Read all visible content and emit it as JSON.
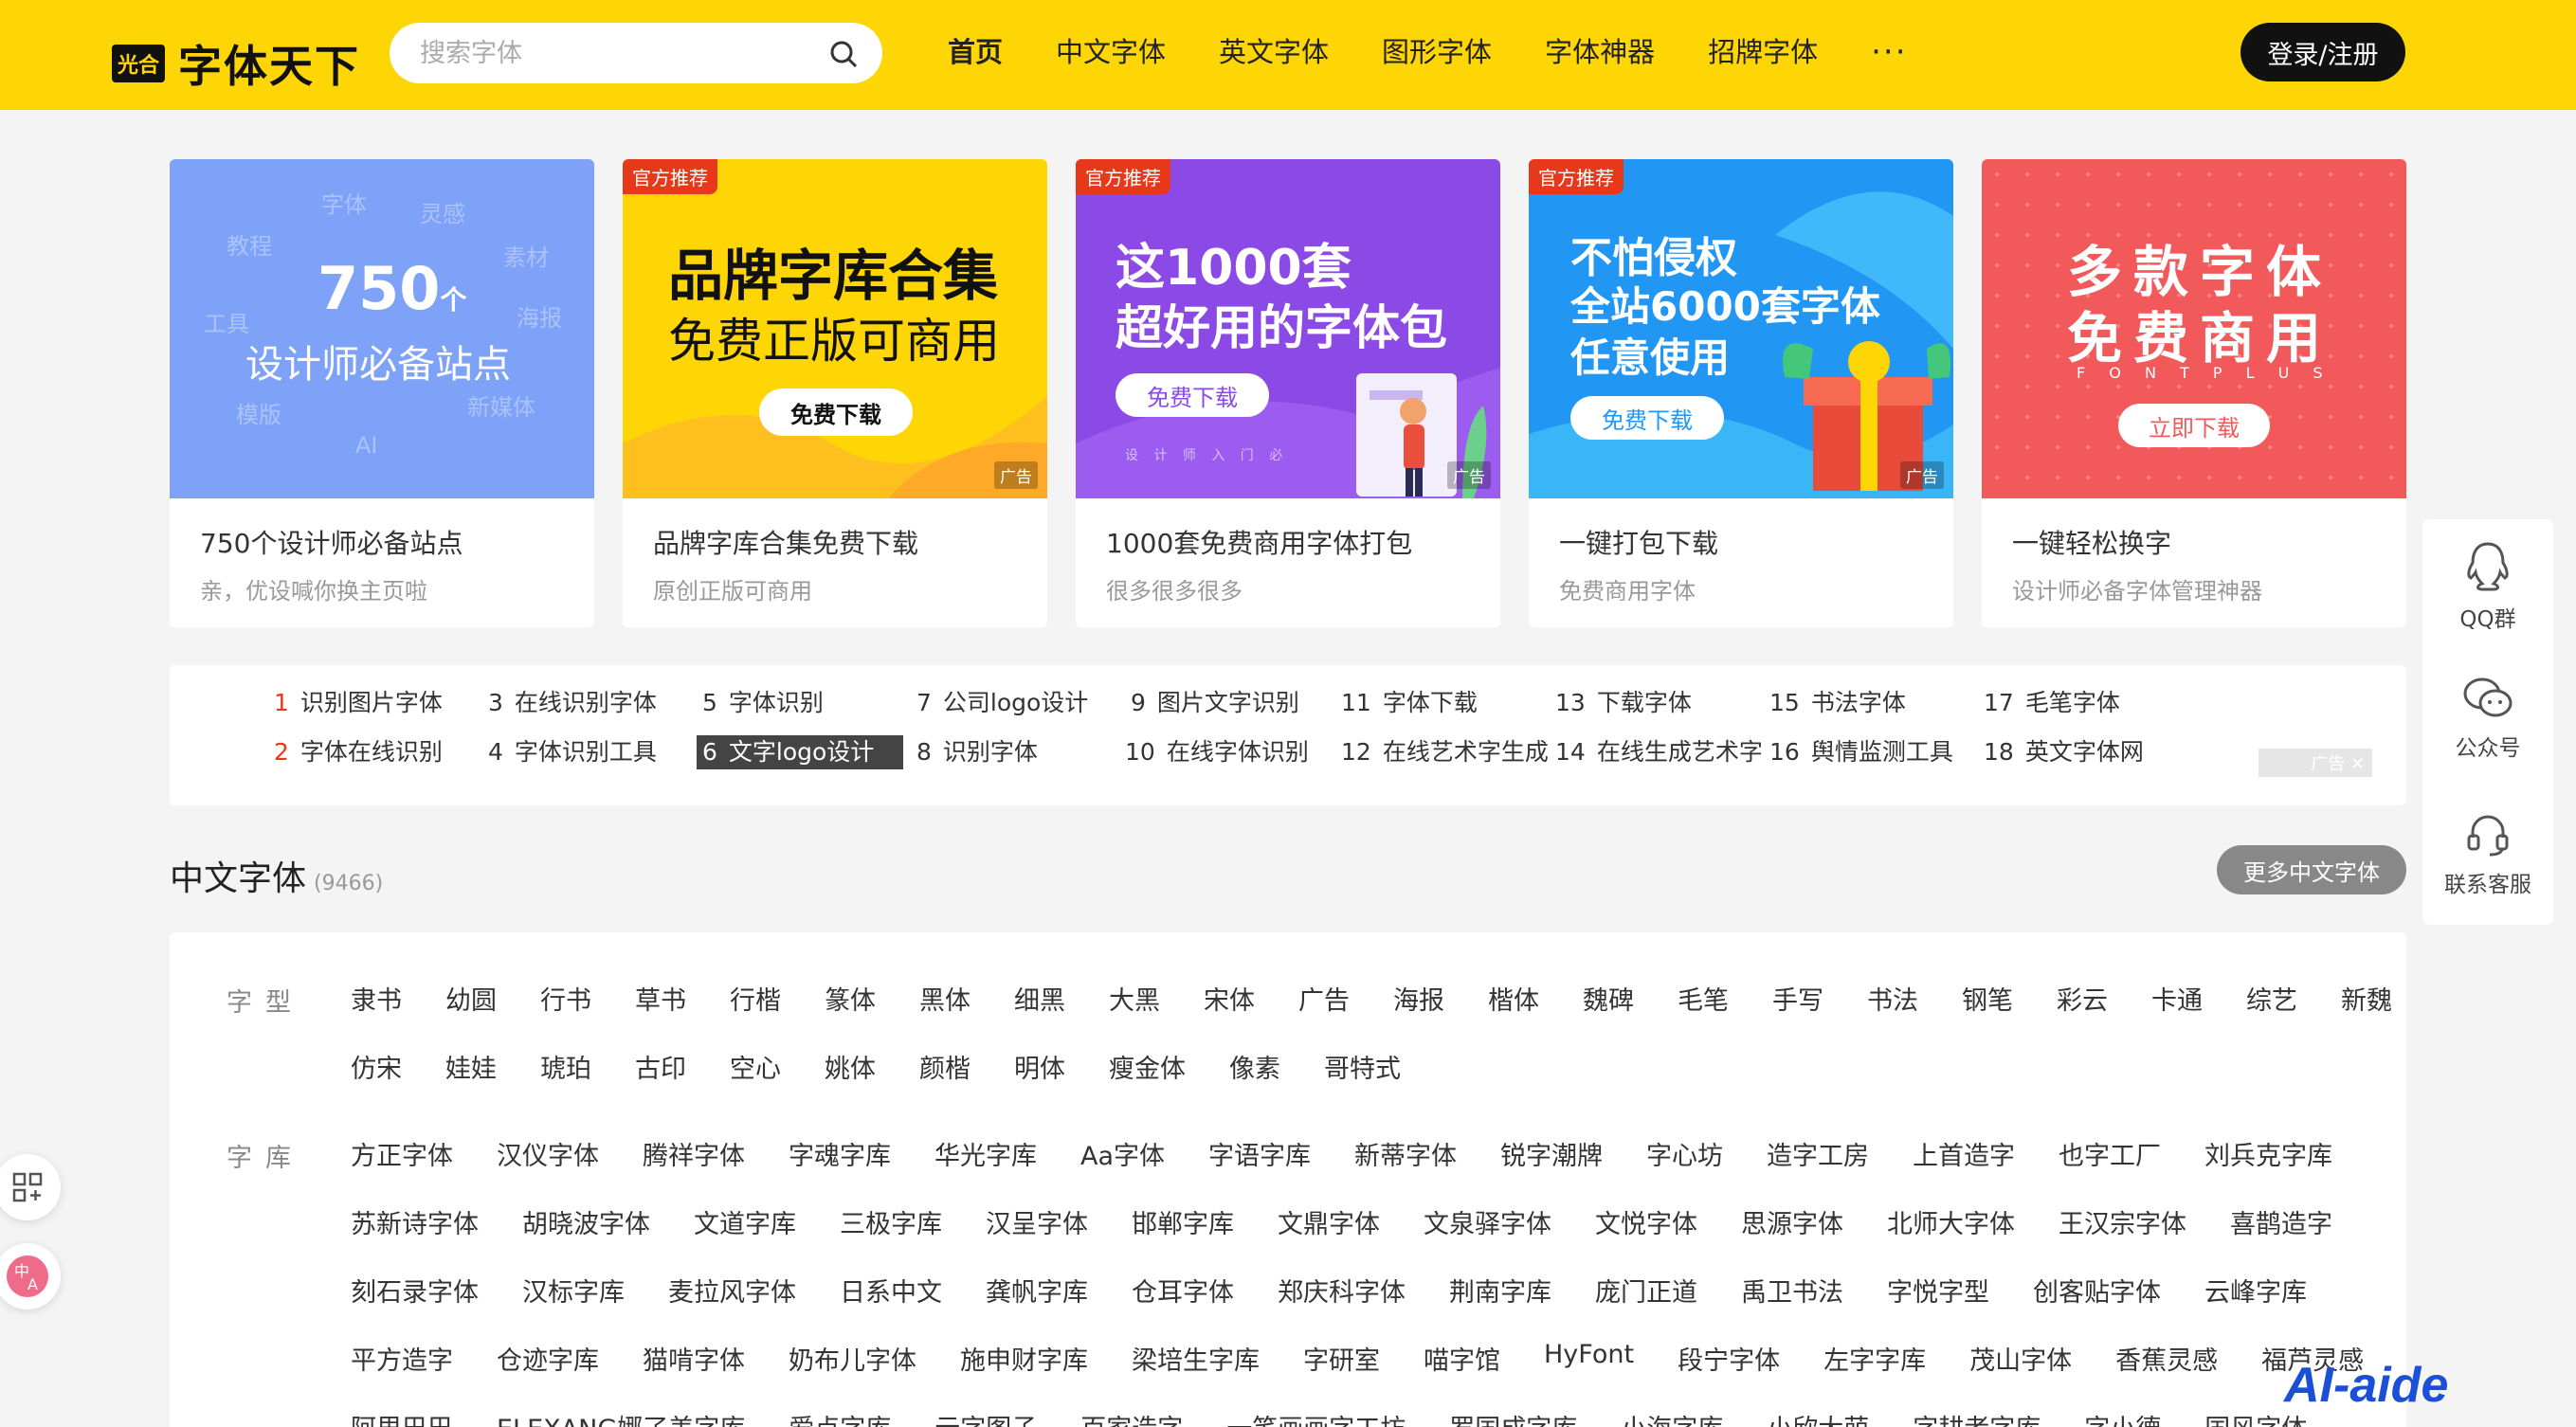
{
  "header": {
    "logo_badge": "光合",
    "logo_text": "字体天下",
    "search_placeholder": "搜索字体",
    "nav": [
      "首页",
      "中文字体",
      "英文字体",
      "图形字体",
      "字体神器",
      "招牌字体"
    ],
    "more": "···",
    "login": "登录/注册",
    "brand_color": "#fed505"
  },
  "cards": [
    {
      "title": "750个设计师必备站点",
      "sub": "亲，优设喊你换主页啦",
      "banner_num": "750",
      "banner_unit": "个",
      "banner_line": "设计师必备站点",
      "floating_words": [
        "字体",
        "灵感",
        "教程",
        "素材",
        "工具",
        "海报",
        "模版",
        "新媒体",
        "AI"
      ]
    },
    {
      "title": "品牌字库合集免费下载",
      "sub": "原创正版可商用",
      "tag": "官方推荐",
      "line1": "品牌字库合集",
      "line2": "免费正版可商用",
      "button": "免费下载",
      "ad": "广告"
    },
    {
      "title": "1000套免费商用字体打包",
      "sub": "很多很多很多",
      "tag": "官方推荐",
      "line1": "这1000套",
      "line2": "超好用的字体包",
      "button": "免费下载",
      "steps": "设  计  师  入  门  必",
      "ad": "广告"
    },
    {
      "title": "一键打包下载",
      "sub": "免费商用字体",
      "tag": "官方推荐",
      "line1": "不怕侵权",
      "line2": "全站6000套字体",
      "line3": "任意使用",
      "button": "免费下载",
      "ad": "广告"
    },
    {
      "title": "一键轻松换字",
      "sub": "设计师必备字体管理神器",
      "line1": "多款字体",
      "line2": "免费商用",
      "line3": "F O N T P L U S",
      "button": "立即下载"
    }
  ],
  "hot": {
    "items": [
      {
        "n": "1",
        "t": "识别图片字体"
      },
      {
        "n": "2",
        "t": "字体在线识别"
      },
      {
        "n": "3",
        "t": "在线识别字体"
      },
      {
        "n": "4",
        "t": "字体识别工具"
      },
      {
        "n": "5",
        "t": "字体识别"
      },
      {
        "n": "6",
        "t": "文字logo设计"
      },
      {
        "n": "7",
        "t": "公司logo设计"
      },
      {
        "n": "8",
        "t": "识别字体"
      },
      {
        "n": "9",
        "t": "图片文字识别"
      },
      {
        "n": "10",
        "t": "在线字体识别"
      },
      {
        "n": "11",
        "t": "字体下载"
      },
      {
        "n": "12",
        "t": "在线艺术字生成"
      },
      {
        "n": "13",
        "t": "下载字体"
      },
      {
        "n": "14",
        "t": "在线生成艺术字"
      },
      {
        "n": "15",
        "t": "书法字体"
      },
      {
        "n": "16",
        "t": "舆情监测工具"
      },
      {
        "n": "17",
        "t": "毛笔字体"
      },
      {
        "n": "18",
        "t": "英文字体网"
      }
    ],
    "close_text": "广告 ✕"
  },
  "section": {
    "title": "中文字体",
    "count": "(9466)",
    "more": "更多中文字体"
  },
  "filters": {
    "type_label": "字型",
    "type_row1": [
      "隶书",
      "幼圆",
      "行书",
      "草书",
      "行楷",
      "篆体",
      "黑体",
      "细黑",
      "大黑",
      "宋体",
      "广告",
      "海报",
      "楷体",
      "魏碑",
      "毛笔",
      "手写",
      "书法",
      "钢笔",
      "彩云",
      "卡通",
      "综艺",
      "新魏"
    ],
    "type_row2": [
      "仿宋",
      "娃娃",
      "琥珀",
      "古印",
      "空心",
      "姚体",
      "颜楷",
      "明体",
      "瘦金体",
      "像素",
      "哥特式"
    ],
    "lib_label": "字库",
    "lib_row1": [
      "方正字体",
      "汉仪字体",
      "腾祥字体",
      "字魂字库",
      "华光字库",
      "Aa字体",
      "字语字库",
      "新蒂字体",
      "锐字潮牌",
      "字心坊",
      "造字工房",
      "上首造字",
      "也字工厂",
      "刘兵克字库"
    ],
    "lib_row2": [
      "苏新诗字体",
      "胡晓波字体",
      "文道字库",
      "三极字库",
      "汉呈字体",
      "邯郸字库",
      "文鼎字体",
      "文泉驿字体",
      "文悦字体",
      "思源字体",
      "北师大字体",
      "王汉宗字体",
      "喜鹊造字"
    ],
    "lib_row3": [
      "刻石录字体",
      "汉标字库",
      "麦拉风字体",
      "日系中文",
      "龚帆字库",
      "仓耳字体",
      "郑庆科字体",
      "荆南字库",
      "庞门正道",
      "禹卫书法",
      "字悦字型",
      "创客贴字体",
      "云峰字库"
    ],
    "lib_row4": [
      "平方造字",
      "仓迹字库",
      "猫啃字体",
      "奶布儿字体",
      "施申财字库",
      "梁培生字库",
      "字研室",
      "喵字馆",
      "HyFont",
      "段宁字体",
      "左字字库",
      "茂山字体",
      "香蕉灵感",
      "福芦灵感"
    ],
    "lib_row5": [
      "阿里巴巴",
      "ELEXANG娜了美字库",
      "爱点字库",
      "云字图子",
      "百家造字",
      "一笔画画字工坊",
      "罗国成字库",
      "小海字库",
      "小欣大萌",
      "字耕者字库",
      "字小德",
      "国风字体"
    ]
  },
  "sidebar": {
    "qq": "QQ群",
    "wechat": "公众号",
    "service": "联系客服"
  },
  "watermark": "AI-aide"
}
